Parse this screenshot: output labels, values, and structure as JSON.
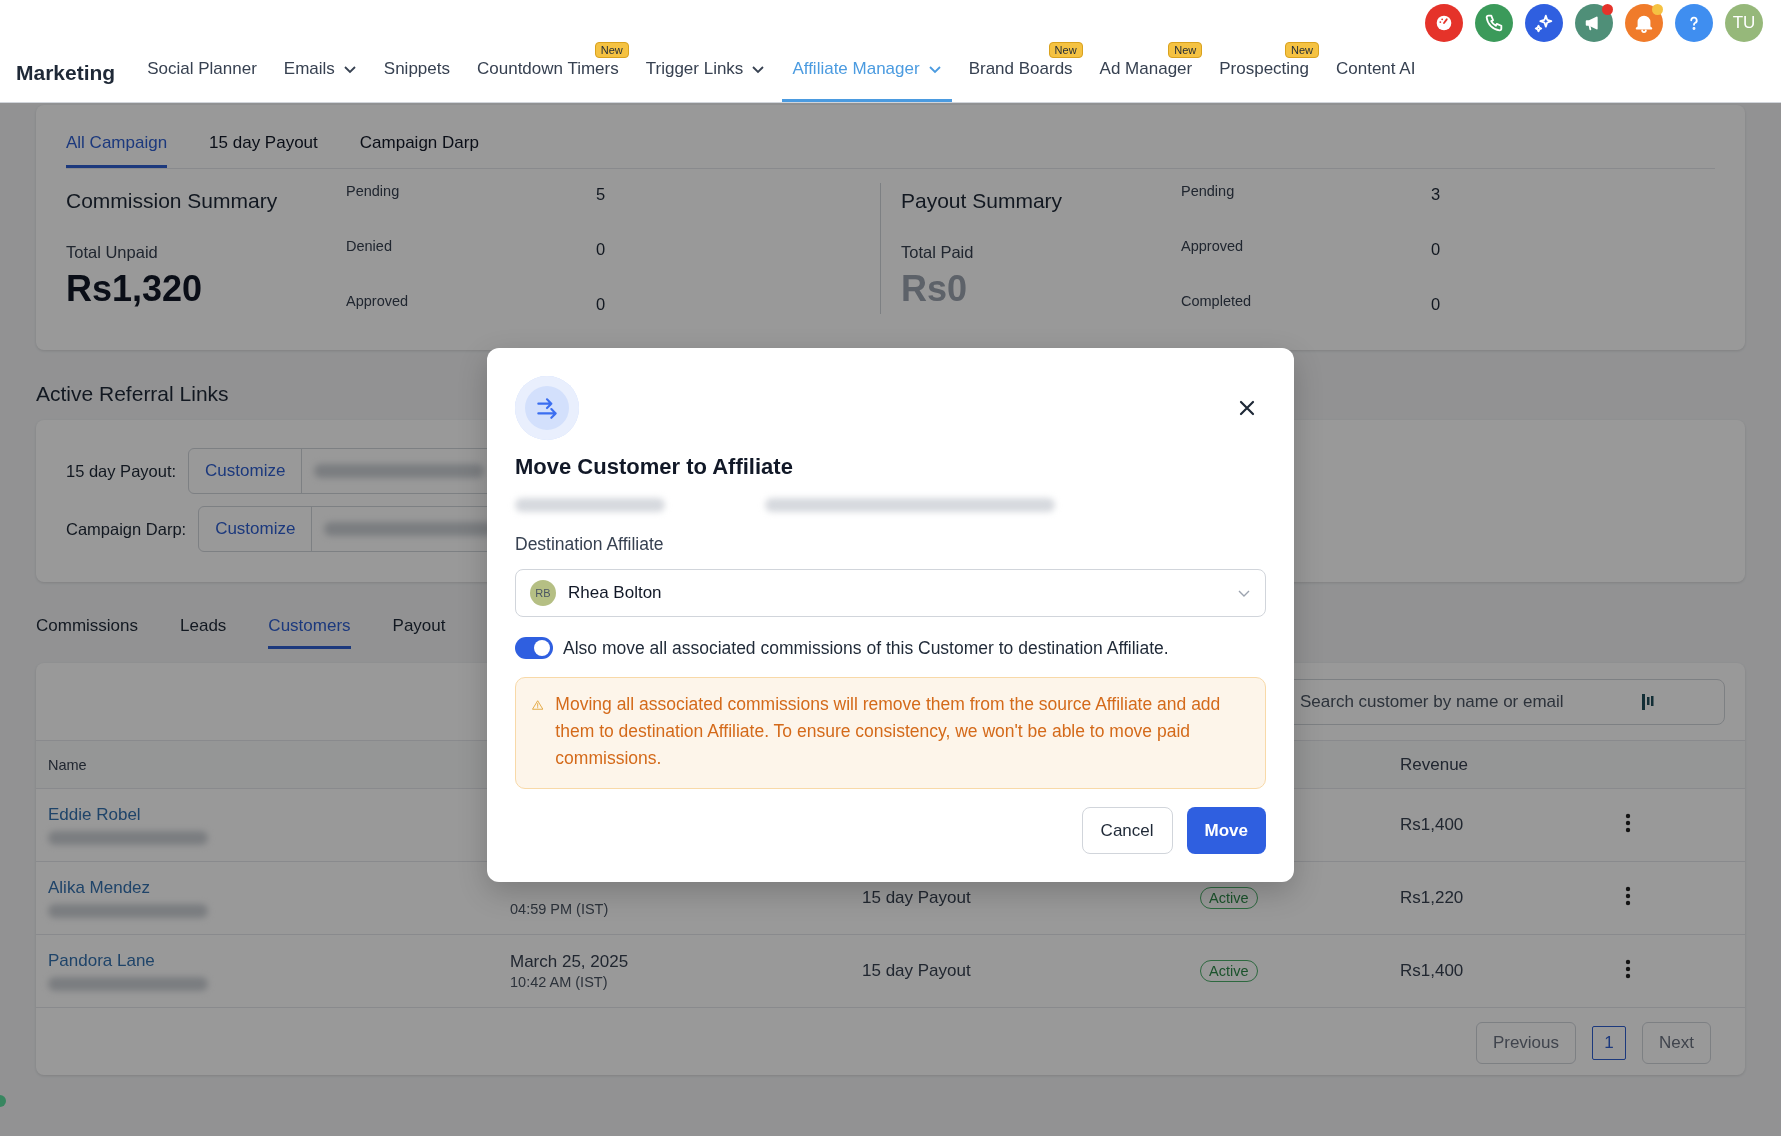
{
  "header": {
    "app_title": "Marketing",
    "nav": [
      {
        "label": "Social Planner",
        "dropdown": false,
        "selected": false
      },
      {
        "label": "Emails",
        "dropdown": true,
        "selected": false
      },
      {
        "label": "Snippets",
        "dropdown": false,
        "selected": false
      },
      {
        "label": "Countdown Timers",
        "dropdown": false,
        "badge": "New",
        "selected": false
      },
      {
        "label": "Trigger Links",
        "dropdown": true,
        "selected": false
      },
      {
        "label": "Affiliate Manager",
        "dropdown": true,
        "selected": true
      },
      {
        "label": "Brand Boards",
        "dropdown": false,
        "badge": "New",
        "selected": false
      },
      {
        "label": "Ad Manager",
        "dropdown": false,
        "badge": "New",
        "selected": false
      },
      {
        "label": "Prospecting",
        "dropdown": false,
        "badge": "New",
        "selected": false
      },
      {
        "label": "Content AI",
        "dropdown": false,
        "selected": false
      }
    ],
    "icons": [
      {
        "kind": "gauge",
        "color": "#e5332a"
      },
      {
        "kind": "phone",
        "color": "#3b9a5a"
      },
      {
        "kind": "sparkle",
        "color": "#2f5fe0"
      },
      {
        "kind": "megaphone",
        "color": "#4f8f78",
        "notification": {
          "color": "#e5332a"
        }
      },
      {
        "kind": "bell",
        "color": "#f07b2a",
        "notification": {
          "color": "#f5c242"
        }
      },
      {
        "kind": "help",
        "color": "#3f8ef0"
      }
    ],
    "avatar": {
      "initials": "TU",
      "color": "#96b87a"
    }
  },
  "campaign_tabs": [
    {
      "label": "All Campaign",
      "selected": true
    },
    {
      "label": "15 day Payout",
      "selected": false
    },
    {
      "label": "Campaign Darp",
      "selected": false
    }
  ],
  "summaries": [
    {
      "title": "Commission Summary",
      "total_label": "Total Unpaid",
      "total": "Rs1,320",
      "muted": false,
      "stats": [
        {
          "label": "Pending",
          "value": "5"
        },
        {
          "label": "Denied",
          "value": "0"
        },
        {
          "label": "Approved",
          "value": "0"
        }
      ]
    },
    {
      "title": "Payout Summary",
      "total_label": "Total Paid",
      "total": "Rs0",
      "muted": true,
      "stats": [
        {
          "label": "Pending",
          "value": "3"
        },
        {
          "label": "Approved",
          "value": "0"
        },
        {
          "label": "Completed",
          "value": "0"
        }
      ]
    }
  ],
  "referral_links": {
    "title": "Active Referral Links",
    "links": [
      {
        "label": "15 day Payout:",
        "button": "Customize"
      },
      {
        "label": "Campaign Darp:",
        "button": "Customize"
      }
    ]
  },
  "section_tabs": [
    {
      "label": "Commissions",
      "selected": false
    },
    {
      "label": "Leads",
      "selected": false
    },
    {
      "label": "Customers",
      "selected": true
    },
    {
      "label": "Payout",
      "selected": false
    }
  ],
  "table": {
    "search_placeholder": "Search customer by name or email",
    "columns": [
      "Name",
      "Revenue"
    ],
    "rows": [
      {
        "name": "Eddie Robel",
        "revenue": "Rs1,400"
      },
      {
        "name": "Alika Mendez",
        "time": "04:59 PM (IST)",
        "campaign": "15 day Payout",
        "status": "Active",
        "revenue": "Rs1,220"
      },
      {
        "name": "Pandora Lane",
        "date": "March 25, 2025",
        "time": "10:42 AM (IST)",
        "campaign": "15 day Payout",
        "status": "Active",
        "revenue": "Rs1,400"
      }
    ]
  },
  "pagination": {
    "previous": "Previous",
    "next": "Next",
    "pages": [
      {
        "label": "1",
        "selected": true
      }
    ]
  },
  "modal": {
    "title": "Move Customer to Affiliate",
    "field_label": "Destination Affiliate",
    "selected_initials": "RB",
    "selected_name": "Rhea Bolton",
    "toggle": {
      "label": "Also move all associated commissions of this Customer to destination Affiliate.",
      "on": true
    },
    "warning": "Moving all associated commissions will remove them from the source Affiliate and add them to destination Affiliate. To ensure consistency, we won't be able to move paid commissions.",
    "cancel": "Cancel",
    "confirm": "Move"
  }
}
